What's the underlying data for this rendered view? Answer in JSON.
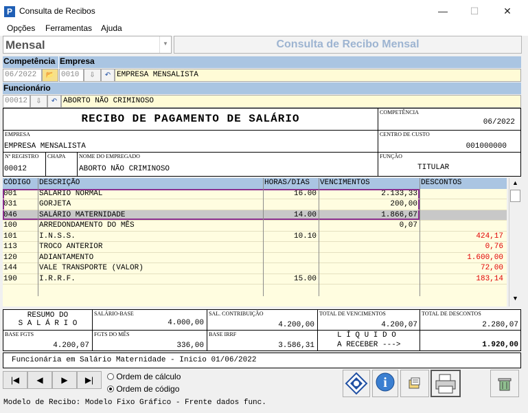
{
  "window": {
    "title": "Consulta de Recibos",
    "minimize": "—",
    "maximize": "☐",
    "close": "✕"
  },
  "menu": [
    "Opções",
    "Ferramentas",
    "Ajuda"
  ],
  "mode_combo": {
    "value": "Mensal"
  },
  "banner": "Consulta de Recibo Mensal",
  "filters": {
    "competencia_label": "Competência",
    "empresa_label": "Empresa",
    "competencia": "06/2022",
    "empresa_code": "0010",
    "empresa_name": "EMPRESA MENSALISTA",
    "funcionario_label": "Funcionário",
    "funcionario_code": "00012",
    "funcionario_name": "ABORTO NÃO CRIMINOSO"
  },
  "receipt": {
    "title": "RECIBO DE PAGAMENTO DE SALÁRIO",
    "competencia_label": "COMPETÊNCIA",
    "competencia": "06/2022",
    "empresa_label": "EMPRESA",
    "empresa": "EMPRESA MENSALISTA",
    "centro_custo_label": "CENTRO DE CUSTO",
    "centro_custo": "001000000",
    "registro_label": "Nº REGISTRO",
    "registro": "00012",
    "chapa_label": "CHAPA",
    "chapa": "",
    "nome_label": "NOME DO EMPREGADO",
    "nome": "ABORTO NÃO CRIMINOSO",
    "funcao_label": "FUNÇÃO",
    "funcao": "TITULAR"
  },
  "table": {
    "headers": [
      "CÓDIGO",
      "DESCRIÇÃO",
      "HORAS/DIAS",
      "VENCIMENTOS",
      "DESCONTOS"
    ],
    "rows": [
      {
        "code": "001",
        "desc": "SALÁRIO NORMAL",
        "hours": "16.00",
        "venc": "2.133,33",
        "desc_val": ""
      },
      {
        "code": "031",
        "desc": "GORJETA",
        "hours": "",
        "venc": "200,00",
        "desc_val": ""
      },
      {
        "code": "046",
        "desc": "SALÁRIO MATERNIDADE",
        "hours": "14.00",
        "venc": "1.866,67",
        "desc_val": ""
      },
      {
        "code": "100",
        "desc": "ARREDONDAMENTO DO MÊS",
        "hours": "",
        "venc": "0,07",
        "desc_val": ""
      },
      {
        "code": "101",
        "desc": "I.N.S.S.",
        "hours": "10.10",
        "venc": "",
        "desc_val": "424,17"
      },
      {
        "code": "113",
        "desc": "TROCO ANTERIOR",
        "hours": "",
        "venc": "",
        "desc_val": "0,76"
      },
      {
        "code": "120",
        "desc": "ADIANTAMENTO",
        "hours": "",
        "venc": "",
        "desc_val": "1.600,00"
      },
      {
        "code": "144",
        "desc": "VALE TRANSPORTE (VALOR)",
        "hours": "",
        "venc": "",
        "desc_val": "72,00"
      },
      {
        "code": "190",
        "desc": "I.R.R.F.",
        "hours": "15.00",
        "venc": "",
        "desc_val": "183,14"
      }
    ]
  },
  "summary": {
    "resumo_line1": "RESUMO DO",
    "resumo_line2": "S A L Á R I O",
    "salario_base_label": "SALÁRIO-BASE",
    "salario_base": "4.000,00",
    "sal_contrib_label": "SAL. CONTRIBUIÇÃO",
    "sal_contrib": "4.200,00",
    "total_venc_label": "TOTAL DE VENCIMENTOS",
    "total_venc": "4.200,07",
    "total_desc_label": "TOTAL DE DESCONTOS",
    "total_desc": "2.280,07",
    "base_fgts_label": "BASE FGTS",
    "base_fgts": "4.200,07",
    "fgts_mes_label": "FGTS DO MÊS",
    "fgts_mes": "336,00",
    "base_irrf_label": "BASE IRRF",
    "base_irrf": "3.586,31",
    "liquido_line1": "L Í Q U I D O",
    "liquido_line2": "A RECEBER --->",
    "liquido": "1.920,00"
  },
  "message": "Funcionária em Salário Maternidade - Inicio 01/06/2022",
  "order": {
    "opt1": "Ordem de cálculo",
    "opt2": "Ordem de código",
    "selected": "Ordem de código"
  },
  "status": "Modelo de Recibo: Modelo Fixo Gráfico - Frente dados func.",
  "colors": {
    "header_blue": "#aac5e2",
    "yellow_bg": "#fffde0",
    "discount_red": "#e00000",
    "highlight_purple": "#8b2f8f"
  }
}
